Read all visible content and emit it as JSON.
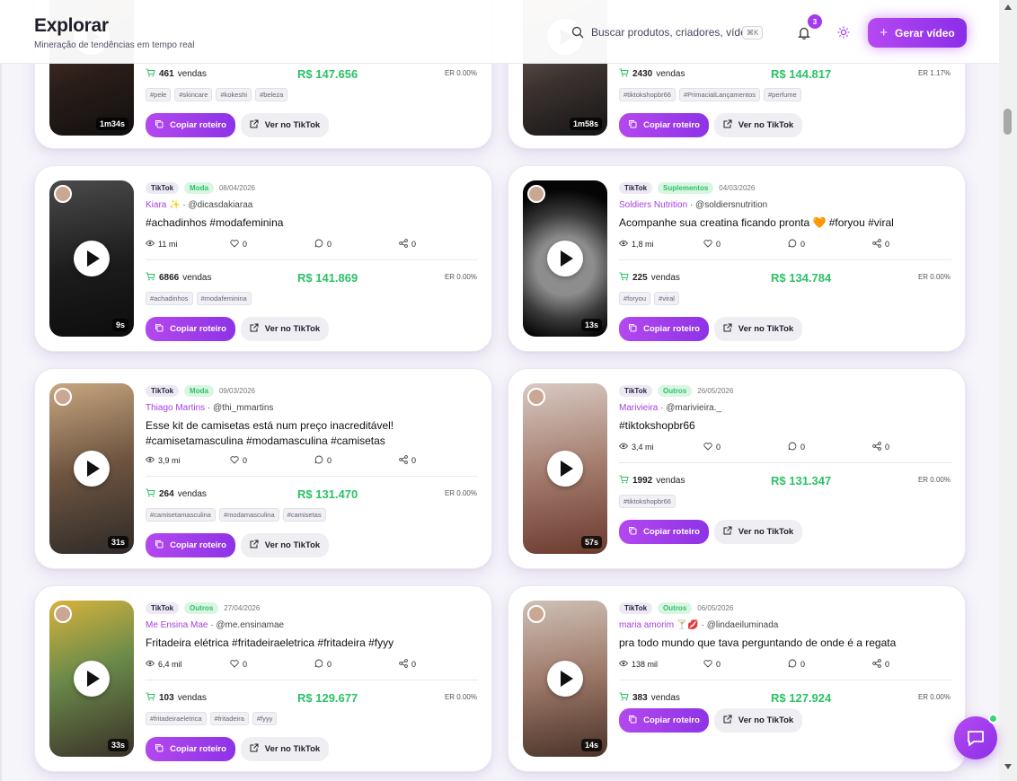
{
  "header": {
    "title": "Explorar",
    "subtitle": "Mineração de tendências em tempo real",
    "search_placeholder": "Buscar produtos, criadores, vídeos...",
    "search_shortcut": "⌘K",
    "notifications_count": "3",
    "generate_label": "Gerar vídeo"
  },
  "labels": {
    "sales_suffix": "vendas",
    "copy_label": "Copiar roteiro",
    "tiktok_label": "Ver no TikTok"
  },
  "cards": [
    {
      "sales": "461",
      "revenue": "R$ 147.656",
      "er": "ER 0.00%",
      "hashtags": [
        "#pele",
        "#skincare",
        "#kokeshi",
        "#beleza"
      ],
      "duration": "1m34s"
    },
    {
      "sales": "2430",
      "revenue": "R$ 144.817",
      "er": "ER 1.17%",
      "hashtags": [
        "#tiktokshopbr66",
        "#PrimacialLançamentos",
        "#perfume"
      ],
      "duration": "1m58s"
    },
    {
      "platform": "TikTok",
      "category": "Moda",
      "date": "08/04/2026",
      "creator": "Kiara ✨",
      "handle": "· @dicasdakiaraa",
      "caption": "#achadinhos #modafeminina",
      "views": "11 mi",
      "likes": "0",
      "comments": "0",
      "shares": "0",
      "sales": "6866",
      "revenue": "R$ 141.869",
      "er": "ER 0.00%",
      "hashtags": [
        "#achadinhos",
        "#modafeminina"
      ],
      "duration": "9s"
    },
    {
      "platform": "TikTok",
      "category": "Suplementos",
      "date": "04/03/2026",
      "creator": "Soldiers Nutrition",
      "handle": "· @soldiersnutrition",
      "caption": "Acompanhe sua creatina ficando pronta 🧡 #foryou #viral",
      "views": "1,8 mi",
      "likes": "0",
      "comments": "0",
      "shares": "0",
      "sales": "225",
      "revenue": "R$ 134.784",
      "er": "ER 0.00%",
      "hashtags": [
        "#foryou",
        "#viral"
      ],
      "duration": "13s"
    },
    {
      "platform": "TikTok",
      "category": "Moda",
      "date": "09/03/2026",
      "creator": "Thiago Martins",
      "handle": "· @thi_mmartins",
      "caption": "Esse kit de camisetas está num preço inacreditável! #camisetamasculina #modamasculina #camisetas",
      "views": "3,9 mi",
      "likes": "0",
      "comments": "0",
      "shares": "0",
      "sales": "264",
      "revenue": "R$ 131.470",
      "er": "ER 0.00%",
      "hashtags": [
        "#camisetamasculina",
        "#modamasculina",
        "#camisetas"
      ],
      "duration": "31s"
    },
    {
      "platform": "TikTok",
      "category": "Outros",
      "date": "26/05/2026",
      "creator": "Marivieira",
      "handle": "· @marivieira._",
      "caption": "#tiktokshopbr66",
      "views": "3,4 mi",
      "likes": "0",
      "comments": "0",
      "shares": "0",
      "sales": "1992",
      "revenue": "R$ 131.347",
      "er": "ER 0.00%",
      "hashtags": [
        "#tiktokshopbr66"
      ],
      "duration": "57s"
    },
    {
      "platform": "TikTok",
      "category": "Outros",
      "date": "27/04/2026",
      "creator": "Me Ensina Mae",
      "handle": "· @me.ensinamae",
      "caption": "Fritadeira elétrica #fritadeiraeletrica #fritadeira #fyyy",
      "views": "6,4 mil",
      "likes": "0",
      "comments": "0",
      "shares": "0",
      "sales": "103",
      "revenue": "R$ 129.677",
      "er": "ER 0.00%",
      "hashtags": [
        "#fritadeiraeletrica",
        "#fritadeira",
        "#fyyy"
      ],
      "duration": "33s"
    },
    {
      "platform": "TikTok",
      "category": "Outros",
      "date": "06/05/2026",
      "creator": "maria amorim 🍸💋",
      "handle": "· @lindaeiluminada",
      "caption": "pra todo mundo que tava perguntando de onde é a regata",
      "views": "138 mil",
      "likes": "0",
      "comments": "0",
      "shares": "0",
      "sales": "383",
      "revenue": "R$ 127.924",
      "er": "ER 0.00%",
      "hashtags": [],
      "duration": "14s"
    }
  ],
  "colors": {
    "accent": "#a33bf0",
    "revenue_green": "#2cc266",
    "category_bg": "#daf6e3"
  }
}
